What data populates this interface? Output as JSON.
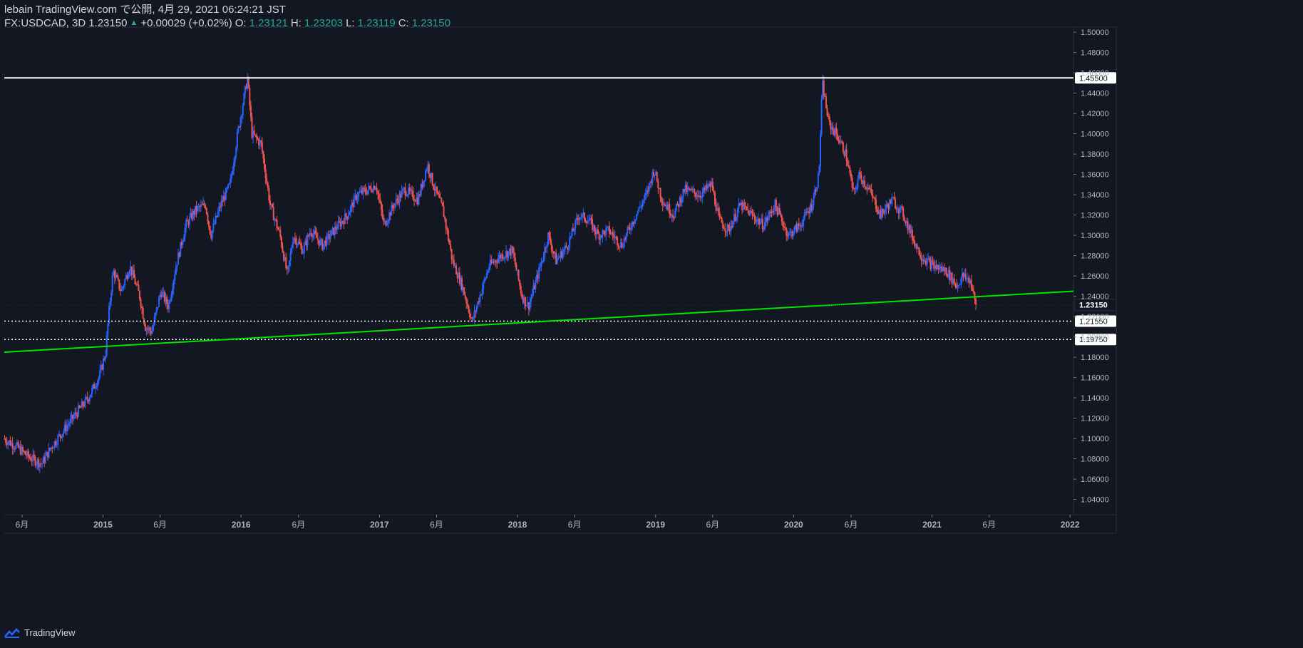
{
  "header": {
    "line1": "lebain TradingView.com で公開, 4月 29, 2021 06:24:21 JST",
    "symbol": "FX:USDCAD, 3D",
    "last": "1.23150",
    "change": "+0.00029 (+0.02%)",
    "o_label": "O:",
    "o_value": "1.23121",
    "h_label": "H:",
    "h_value": "1.23203",
    "l_label": "L:",
    "l_value": "1.23119",
    "c_label": "C:",
    "c_value": "1.23150"
  },
  "footer": {
    "brand": "TradingView"
  },
  "colors": {
    "background": "#131722",
    "up": "#2962ff",
    "down": "#ef5350",
    "grid": "#1c2030",
    "axis_text": "#b2b5be",
    "trendline": "#00e600",
    "resistance": "#ffffff",
    "change_text": "#26a69a"
  },
  "chart_data": {
    "type": "candlestick",
    "y_ticks": [
      "1.50000",
      "1.48000",
      "1.46000",
      "1.44000",
      "1.42000",
      "1.40000",
      "1.38000",
      "1.36000",
      "1.34000",
      "1.32000",
      "1.30000",
      "1.28000",
      "1.26000",
      "1.24000",
      "1.22000",
      "1.20000",
      "1.18000",
      "1.16000",
      "1.14000",
      "1.12000",
      "1.10000",
      "1.08000",
      "1.06000",
      "1.04000"
    ],
    "ylim": [
      1.025,
      1.505
    ],
    "x_ticks": [
      {
        "label": "6月",
        "date": "2014-06-01"
      },
      {
        "label": "2015",
        "date": "2015-01-01"
      },
      {
        "label": "6月",
        "date": "2015-06-01"
      },
      {
        "label": "2016",
        "date": "2016-01-01"
      },
      {
        "label": "6月",
        "date": "2016-06-01"
      },
      {
        "label": "2017",
        "date": "2017-01-01"
      },
      {
        "label": "6月",
        "date": "2017-06-01"
      },
      {
        "label": "2018",
        "date": "2018-01-01"
      },
      {
        "label": "6月",
        "date": "2018-06-01"
      },
      {
        "label": "2019",
        "date": "2019-01-01"
      },
      {
        "label": "6月",
        "date": "2019-06-01"
      },
      {
        "label": "2020",
        "date": "2020-01-01"
      },
      {
        "label": "6月",
        "date": "2020-06-01"
      },
      {
        "label": "2021",
        "date": "2021-01-01"
      },
      {
        "label": "6月",
        "date": "2021-06-01"
      },
      {
        "label": "2022",
        "date": "2022-01-01"
      }
    ],
    "xlim": [
      "2014-04-15",
      "2022-01-10"
    ],
    "price_path": [
      [
        "2014-04-15",
        1.1
      ],
      [
        "2014-05-20",
        1.092
      ],
      [
        "2014-06-20",
        1.082
      ],
      [
        "2014-07-25",
        1.075
      ],
      [
        "2014-08-20",
        1.092
      ],
      [
        "2014-09-25",
        1.11
      ],
      [
        "2014-10-25",
        1.125
      ],
      [
        "2014-11-25",
        1.14
      ],
      [
        "2014-12-25",
        1.162
      ],
      [
        "2015-01-10",
        1.185
      ],
      [
        "2015-01-20",
        1.23
      ],
      [
        "2015-01-30",
        1.265
      ],
      [
        "2015-02-20",
        1.245
      ],
      [
        "2015-03-15",
        1.27
      ],
      [
        "2015-04-10",
        1.24
      ],
      [
        "2015-04-25",
        1.21
      ],
      [
        "2015-05-12",
        1.205
      ],
      [
        "2015-06-05",
        1.245
      ],
      [
        "2015-06-25",
        1.23
      ],
      [
        "2015-07-15",
        1.27
      ],
      [
        "2015-08-10",
        1.31
      ],
      [
        "2015-09-05",
        1.325
      ],
      [
        "2015-10-01",
        1.33
      ],
      [
        "2015-10-15",
        1.3
      ],
      [
        "2015-11-10",
        1.33
      ],
      [
        "2015-12-05",
        1.35
      ],
      [
        "2015-12-25",
        1.4
      ],
      [
        "2016-01-20",
        1.455
      ],
      [
        "2016-02-01",
        1.4
      ],
      [
        "2016-02-25",
        1.39
      ],
      [
        "2016-03-20",
        1.33
      ],
      [
        "2016-04-15",
        1.3
      ],
      [
        "2016-05-05",
        1.26
      ],
      [
        "2016-05-20",
        1.3
      ],
      [
        "2016-06-15",
        1.285
      ],
      [
        "2016-07-05",
        1.305
      ],
      [
        "2016-08-05",
        1.29
      ],
      [
        "2016-09-05",
        1.305
      ],
      [
        "2016-10-10",
        1.32
      ],
      [
        "2016-11-05",
        1.34
      ],
      [
        "2016-12-05",
        1.345
      ],
      [
        "2016-12-25",
        1.35
      ],
      [
        "2017-01-15",
        1.31
      ],
      [
        "2017-02-10",
        1.33
      ],
      [
        "2017-03-10",
        1.345
      ],
      [
        "2017-04-15",
        1.335
      ],
      [
        "2017-05-10",
        1.37
      ],
      [
        "2017-05-25",
        1.35
      ],
      [
        "2017-06-20",
        1.325
      ],
      [
        "2017-07-15",
        1.275
      ],
      [
        "2017-08-10",
        1.25
      ],
      [
        "2017-09-05",
        1.215
      ],
      [
        "2017-09-25",
        1.24
      ],
      [
        "2017-10-20",
        1.27
      ],
      [
        "2017-11-20",
        1.28
      ],
      [
        "2017-12-20",
        1.285
      ],
      [
        "2018-01-15",
        1.24
      ],
      [
        "2018-02-01",
        1.23
      ],
      [
        "2018-03-05",
        1.27
      ],
      [
        "2018-03-25",
        1.3
      ],
      [
        "2018-04-15",
        1.275
      ],
      [
        "2018-05-15",
        1.29
      ],
      [
        "2018-06-15",
        1.32
      ],
      [
        "2018-07-10",
        1.315
      ],
      [
        "2018-08-05",
        1.3
      ],
      [
        "2018-09-01",
        1.305
      ],
      [
        "2018-10-05",
        1.29
      ],
      [
        "2018-11-05",
        1.315
      ],
      [
        "2018-12-10",
        1.34
      ],
      [
        "2018-12-30",
        1.365
      ],
      [
        "2019-01-20",
        1.335
      ],
      [
        "2019-02-20",
        1.32
      ],
      [
        "2019-03-20",
        1.345
      ],
      [
        "2019-05-01",
        1.34
      ],
      [
        "2019-05-31",
        1.35
      ],
      [
        "2019-06-20",
        1.315
      ],
      [
        "2019-07-15",
        1.305
      ],
      [
        "2019-08-15",
        1.33
      ],
      [
        "2019-09-15",
        1.32
      ],
      [
        "2019-10-15",
        1.31
      ],
      [
        "2019-11-15",
        1.33
      ],
      [
        "2019-12-20",
        1.3
      ],
      [
        "2020-01-20",
        1.31
      ],
      [
        "2020-02-20",
        1.33
      ],
      [
        "2020-03-10",
        1.36
      ],
      [
        "2020-03-19",
        1.45
      ],
      [
        "2020-04-05",
        1.41
      ],
      [
        "2020-04-25",
        1.4
      ],
      [
        "2020-05-20",
        1.38
      ],
      [
        "2020-06-10",
        1.34
      ],
      [
        "2020-06-25",
        1.36
      ],
      [
        "2020-07-20",
        1.345
      ],
      [
        "2020-08-20",
        1.32
      ],
      [
        "2020-09-20",
        1.335
      ],
      [
        "2020-10-20",
        1.32
      ],
      [
        "2020-11-10",
        1.3
      ],
      [
        "2020-12-05",
        1.28
      ],
      [
        "2021-01-05",
        1.27
      ],
      [
        "2021-02-10",
        1.265
      ],
      [
        "2021-03-10",
        1.25
      ],
      [
        "2021-03-25",
        1.26
      ],
      [
        "2021-04-15",
        1.255
      ],
      [
        "2021-04-28",
        1.2315
      ]
    ],
    "lines": [
      {
        "name": "resistance",
        "type": "horizontal",
        "value": 1.455,
        "label": "1.45500"
      },
      {
        "name": "support-1",
        "type": "horizontal-dotted",
        "value": 1.2155,
        "label": "1.21550"
      },
      {
        "name": "support-2",
        "type": "horizontal-dotted",
        "value": 1.1975,
        "label": "1.19750"
      },
      {
        "name": "trendline",
        "type": "trend",
        "points": [
          [
            "2014-04-15",
            1.185
          ],
          [
            "2022-01-10",
            1.245
          ]
        ]
      }
    ],
    "last_price": {
      "value": 1.2315,
      "label": "1.23150"
    }
  }
}
